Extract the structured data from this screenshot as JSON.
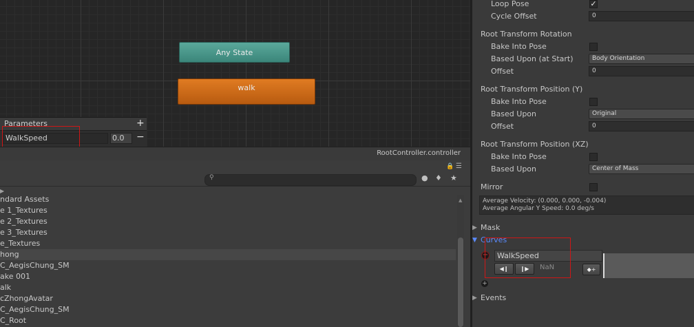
{
  "animator": {
    "states": {
      "any_state": "Any State",
      "walk": "walk"
    },
    "parameters": {
      "title": "Parameters",
      "add_icon": "plus-icon",
      "items": [
        {
          "name": "WalkSpeed",
          "value": "0.0"
        }
      ],
      "remove_icon": "minus-icon"
    },
    "controller_name": "RootController.controller"
  },
  "project": {
    "toolbar_icons": [
      "lock-icon",
      "menu-icon"
    ],
    "search": {
      "placeholder": "",
      "icon": "search-icon"
    },
    "filter_icons": [
      "filter-type-icon",
      "filter-label-icon",
      "star-icon"
    ],
    "assets": [
      "ndard Assets",
      "e 1_Textures",
      "e 2_Textures",
      "e 3_Textures",
      "e_Textures",
      "hong",
      "C_AegisChung_SM",
      "ake 001",
      "alk",
      "cZhongAvatar",
      "C_AegisChung_SM",
      "C_Root"
    ],
    "selected_index": 5
  },
  "inspector": {
    "loop_pose": {
      "label": "Loop Pose",
      "checked": true
    },
    "cycle_offset": {
      "label": "Cycle Offset",
      "value": "0"
    },
    "root_rotation": {
      "title": "Root Transform Rotation",
      "bake_label": "Bake Into Pose",
      "based_label": "Based Upon (at Start)",
      "based_value": "Body Orientation",
      "offset_label": "Offset",
      "offset_value": "0"
    },
    "root_position_y": {
      "title": "Root Transform Position (Y)",
      "bake_label": "Bake Into Pose",
      "based_label": "Based Upon",
      "based_value": "Original",
      "offset_label": "Offset",
      "offset_value": "0"
    },
    "root_position_xz": {
      "title": "Root Transform Position (XZ)",
      "bake_label": "Bake Into Pose",
      "based_label": "Based Upon",
      "based_value": "Center of Mass"
    },
    "mirror": {
      "label": "Mirror"
    },
    "info": {
      "line1": "Average Velocity: (0.000, 0.000, -0.004)",
      "line2": "Average Angular Y Speed: 0.0 deg/s"
    },
    "mask_label": "Mask",
    "curves": {
      "label": "Curves",
      "curve_name": "WalkSpeed",
      "prev_key_icon": "prev-key-icon",
      "next_key_icon": "next-key-icon",
      "value": "NaN",
      "options_icon": "add-key-icon"
    },
    "events_label": "Events",
    "accent": "#5a8bff"
  }
}
